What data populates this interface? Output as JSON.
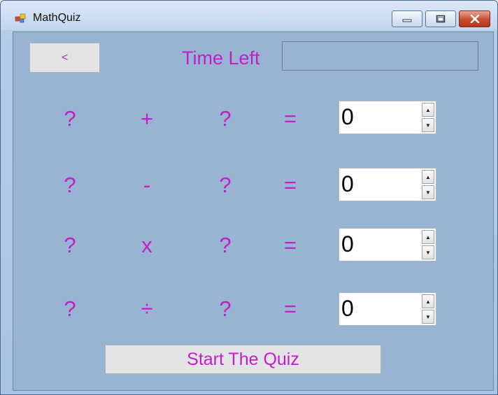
{
  "window": {
    "title": "MathQuiz",
    "controls": {
      "minimize": "minimize-icon",
      "maximize": "maximize-icon",
      "close": "close-icon"
    }
  },
  "header": {
    "back_label": "<",
    "time_label": "Time Left",
    "time_value": ""
  },
  "problems": [
    {
      "left": "?",
      "operator": "+",
      "right": "?",
      "equals": "=",
      "answer": "0"
    },
    {
      "left": "?",
      "operator": "-",
      "right": "?",
      "equals": "=",
      "answer": "0"
    },
    {
      "left": "?",
      "operator": "x",
      "right": "?",
      "equals": "=",
      "answer": "0"
    },
    {
      "left": "?",
      "operator": "÷",
      "right": "?",
      "equals": "=",
      "answer": "0"
    }
  ],
  "start_button": "Start The Quiz",
  "colors": {
    "accent_text": "#c020c8",
    "form_background": "#98b4d2"
  }
}
